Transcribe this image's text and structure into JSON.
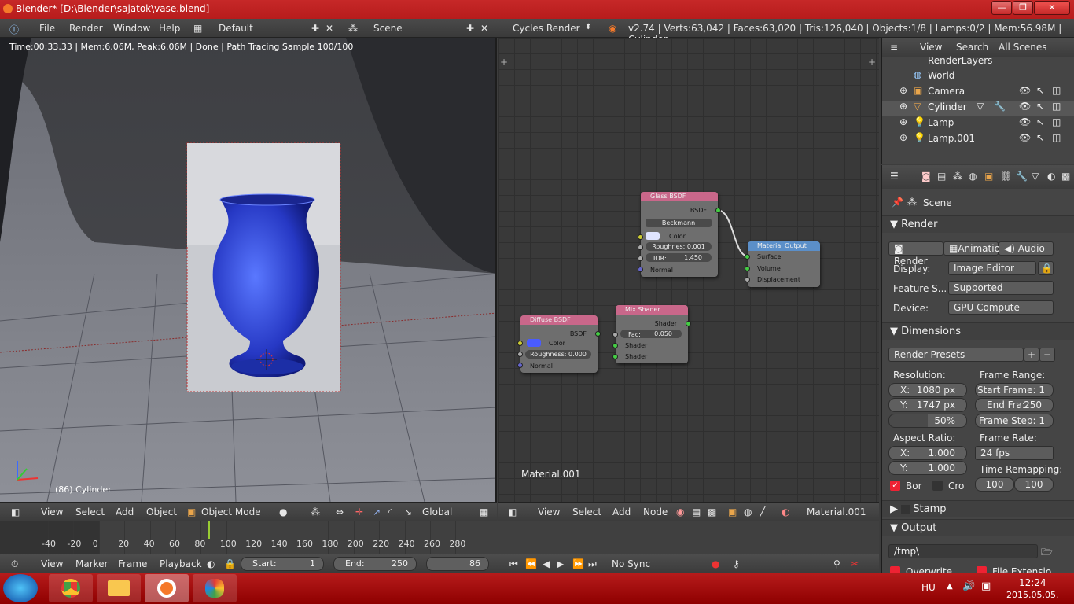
{
  "window": {
    "title": "Blender* [D:\\Blender\\sajatok\\vase.blend]",
    "min": "—",
    "max": "❐",
    "close": "✕"
  },
  "menubar": {
    "items": [
      "File",
      "Render",
      "Window",
      "Help"
    ],
    "layout": "Default",
    "scene": "Scene",
    "engine": "Cycles Render",
    "stats": "v2.74 | Verts:63,042 | Faces:63,020 | Tris:126,040 | Objects:1/8 | Lamps:0/2 | Mem:56.98M | Cylinder"
  },
  "viewport": {
    "info": "Time:00:33.33 | Mem:6.06M, Peak:6.06M | Done | Path Tracing Sample 100/100",
    "object_label": "(86) Cylinder",
    "header": {
      "items": [
        "View",
        "Select",
        "Add",
        "Object"
      ],
      "mode": "Object Mode",
      "orientation": "Global"
    }
  },
  "node_editor": {
    "material_label": "Material.001",
    "header": {
      "items": [
        "View",
        "Select",
        "Add",
        "Node"
      ],
      "material": "Material.001"
    },
    "nodes": {
      "glass": {
        "title": "Glass BSDF",
        "out": "BSDF",
        "distribution": "Beckmann",
        "color": "Color",
        "roughness": "Roughnes: 0.001",
        "ior_label": "IOR:",
        "ior": "1.450",
        "normal": "Normal"
      },
      "output": {
        "title": "Material Output",
        "surface": "Surface",
        "volume": "Volume",
        "displacement": "Displacement"
      },
      "diffuse": {
        "title": "Diffuse BSDF",
        "out": "BSDF",
        "color": "Color",
        "roughness": "Roughness: 0.000",
        "normal": "Normal"
      },
      "mix": {
        "title": "Mix Shader",
        "out": "Shader",
        "fac_label": "Fac:",
        "fac": "0.050",
        "in1": "Shader",
        "in2": "Shader"
      }
    }
  },
  "outliner": {
    "header": {
      "view": "View",
      "search": "Search",
      "filter": "All Scenes"
    },
    "items": [
      "RenderLayers",
      "World",
      "Camera",
      "Cylinder",
      "Lamp",
      "Lamp.001"
    ]
  },
  "properties": {
    "context": "Scene",
    "render": {
      "title": "Render",
      "buttons": [
        "Render",
        "Animation",
        "Audio"
      ],
      "display_label": "Display:",
      "display": "Image Editor",
      "feature_label": "Feature S...",
      "feature": "Supported",
      "device_label": "Device:",
      "device": "GPU Compute"
    },
    "dimensions": {
      "title": "Dimensions",
      "presets": "Render Presets",
      "resolution_label": "Resolution:",
      "res_x": "X:",
      "res_x_val": "1080 px",
      "res_y": "Y:",
      "res_y_val": "1747 px",
      "percent": "50%",
      "frame_range_label": "Frame Range:",
      "start": "Start Frame: 1",
      "end_label": "End Fra:",
      "end": "250",
      "step": "Frame Step: 1",
      "aspect_label": "Aspect Ratio:",
      "asp_x": "X:",
      "asp_x_val": "1.000",
      "asp_y": "Y:",
      "asp_y_val": "1.000",
      "frame_rate_label": "Frame Rate:",
      "frame_rate": "24 fps",
      "remap_label": "Time Remapping:",
      "remap_old": "100",
      "remap_new": "100",
      "border": "Bor",
      "crop": "Cro"
    },
    "stamp": {
      "title": "Stamp"
    },
    "output": {
      "title": "Output",
      "path": "/tmp\\",
      "overwrite": "Overwrite",
      "file_ext": "File Extensio"
    }
  },
  "timeline": {
    "ticks": [
      "-40",
      "-20",
      "0",
      "20",
      "40",
      "60",
      "80",
      "100",
      "120",
      "140",
      "160",
      "180",
      "200",
      "220",
      "240",
      "260",
      "280"
    ],
    "current_frame": 86,
    "header": {
      "items": [
        "View",
        "Marker",
        "Frame",
        "Playback"
      ],
      "start_label": "Start:",
      "start": "1",
      "end_label": "End:",
      "end": "250",
      "current": "86",
      "sync": "No Sync"
    }
  },
  "taskbar": {
    "lang": "HU",
    "time": "12:24",
    "date": "2015.05.05."
  }
}
